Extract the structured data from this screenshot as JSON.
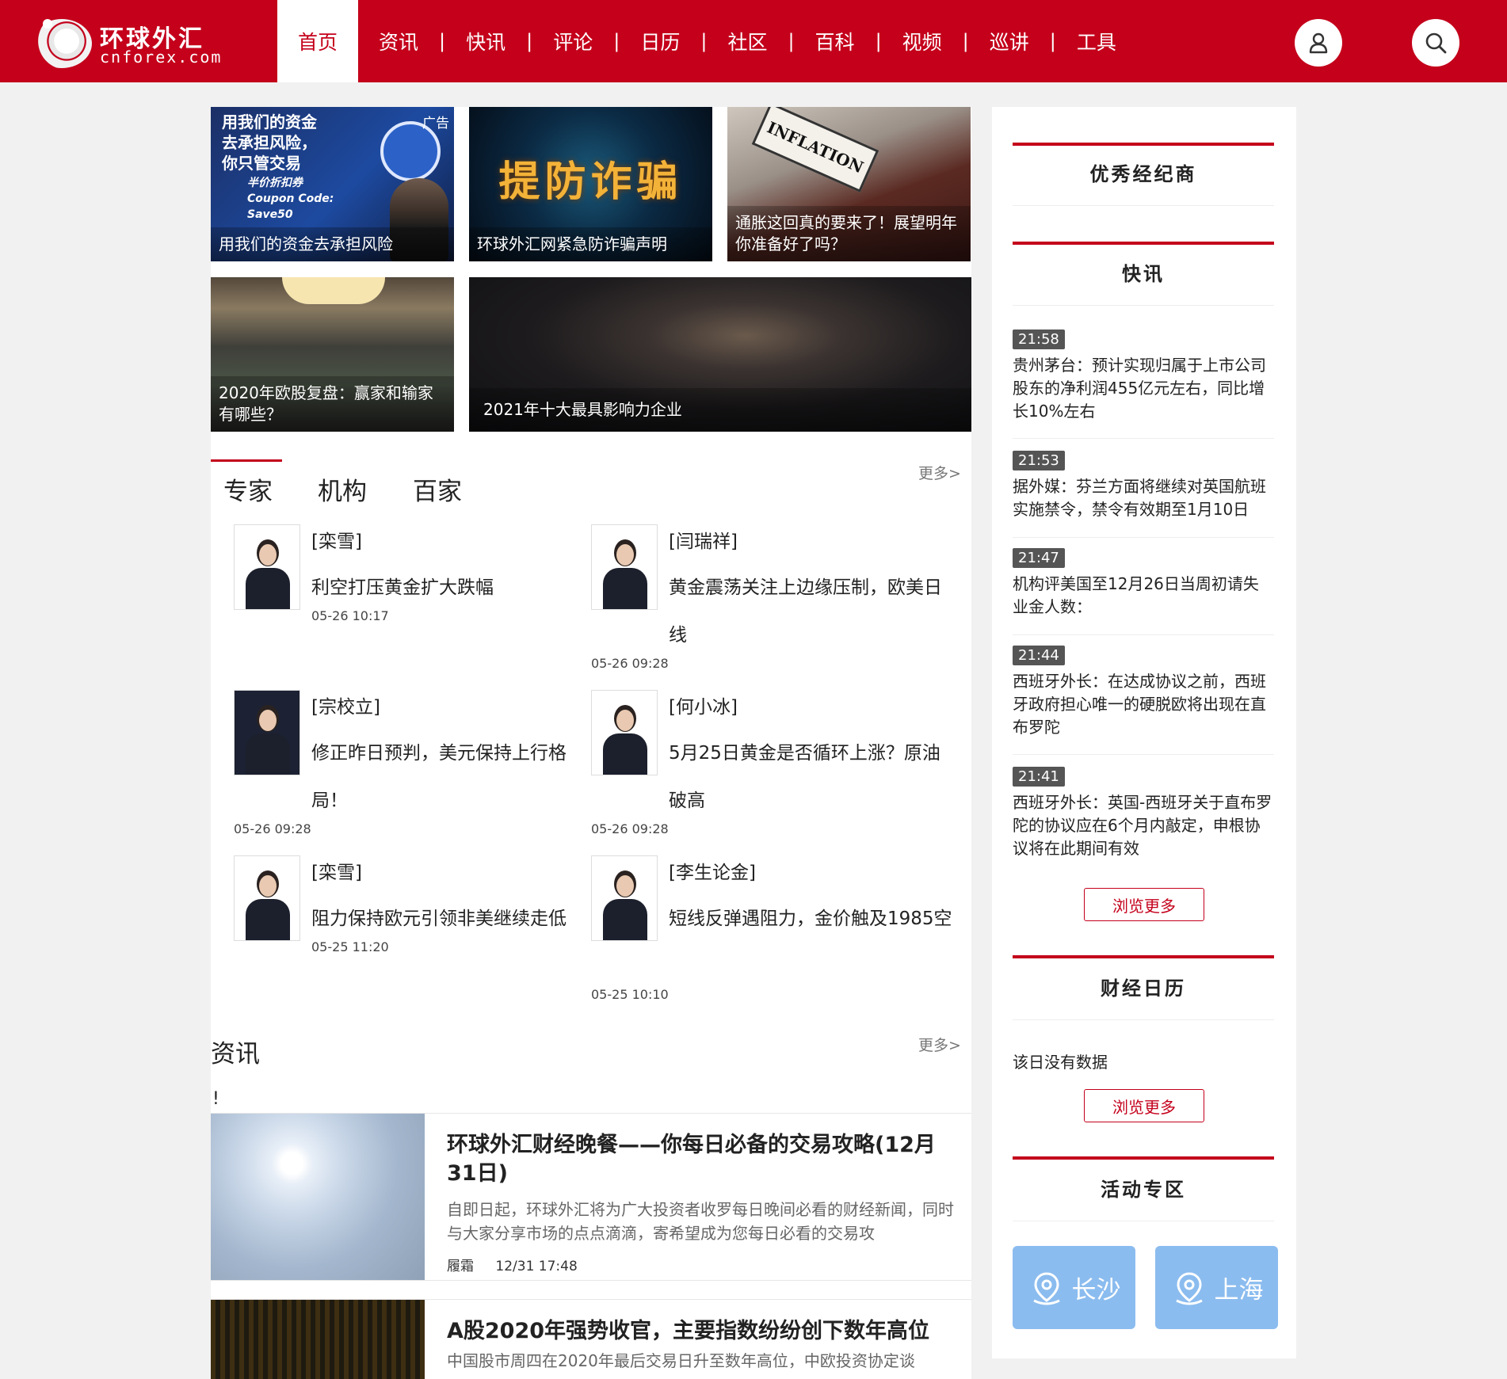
{
  "logo": {
    "cn": "环球外汇",
    "en": "cnforex.com"
  },
  "nav": {
    "active": "首页",
    "items": [
      "资讯",
      "快讯",
      "评论",
      "日历",
      "社区",
      "百科",
      "视频",
      "巡讲",
      "工具"
    ],
    "separator": "|"
  },
  "header_icons": {
    "user": "user-icon",
    "search": "search-icon"
  },
  "tiles": [
    {
      "caption": "用我们的资金去承担风险",
      "ad": "广告",
      "promo_lines": [
        "用我们的资金",
        "去承担风险，",
        "你只管交易"
      ],
      "promo_sub": [
        "半价折扣券",
        "Coupon Code:",
        "Save50"
      ]
    },
    {
      "caption": "环球外汇网紧急防诈骗声明",
      "headline": "提防诈骗"
    },
    {
      "caption": "通胀这回真的要来了！展望明年你准备好了吗？",
      "note": "INFLATION"
    },
    {
      "caption": "2020年欧股复盘：赢家和输家有哪些？"
    },
    {
      "caption": "2021年十大最具影响力企业"
    }
  ],
  "expert_tabs": [
    "专家",
    "机构",
    "百家"
  ],
  "more_label": "更多>",
  "experts": [
    {
      "name": "[栾雪]",
      "title": "利空打压黄金扩大跌幅",
      "time": "05-26 10:17"
    },
    {
      "name": "[闫瑞祥]",
      "title": "黄金震荡关注上边缘压制，欧美日线",
      "time": "05-26 09:28"
    },
    {
      "name": "[宗校立]",
      "title": "修正昨日预判，美元保持上行格局！",
      "time": "05-26 09:28"
    },
    {
      "name": "[何小冰]",
      "title": "5月25日黄金是否循环上涨？原油破高",
      "time": "05-26 09:28"
    },
    {
      "name": "[栾雪]",
      "title": "阻力保持欧元引领非美继续走低",
      "time": "05-25 11:20"
    },
    {
      "name": "[李生论金]",
      "title": "短线反弹遇阻力，金价触及1985空",
      "time": "05-25 10:10"
    }
  ],
  "news_section": {
    "title": "资讯",
    "bang": "!"
  },
  "news": [
    {
      "headline": "环球外汇财经晚餐——你每日必备的交易攻略(12月31日)",
      "summary": "自即日起，环球外汇将为广大投资者收罗每日晚间必看的财经新闻，同时与大家分享市场的点点滴滴，寄希望成为您每日必看的交易攻",
      "author": "履霜",
      "time": "12/31 17:48"
    },
    {
      "headline": "A股2020年强势收官，主要指数纷纷创下数年高位",
      "summary": "中国股市周四在2020年最后交易日升至数年高位，中欧投资协定谈"
    }
  ],
  "sidebar": {
    "brokers_title": "优秀经纪商",
    "flash_title": "快讯",
    "flash": [
      {
        "time": "21:58",
        "text": "贵州茅台：预计实现归属于上市公司股东的净利润455亿元左右，同比增长10%左右"
      },
      {
        "time": "21:53",
        "text": "据外媒：芬兰方面将继续对英国航班实施禁令，禁令有效期至1月10日"
      },
      {
        "time": "21:47",
        "text": "机构评美国至12月26日当周初请失业金人数："
      },
      {
        "time": "21:44",
        "text": "西班牙外长：在达成协议之前，西班牙政府担心唯一的硬脱欧将出现在直布罗陀"
      },
      {
        "time": "21:41",
        "text": "西班牙外长：英国-西班牙关于直布罗陀的协议应在6个月内敲定，申根协议将在此期间有效"
      }
    ],
    "browse_more": "浏览更多",
    "calendar_title": "财经日历",
    "calendar_empty": "该日没有数据",
    "events_title": "活动专区",
    "cities": [
      "长沙",
      "上海"
    ],
    "city_icon": "location-pin-icon"
  },
  "colors": {
    "brand": "#c4001b",
    "city_tile": "#8bbcef"
  }
}
